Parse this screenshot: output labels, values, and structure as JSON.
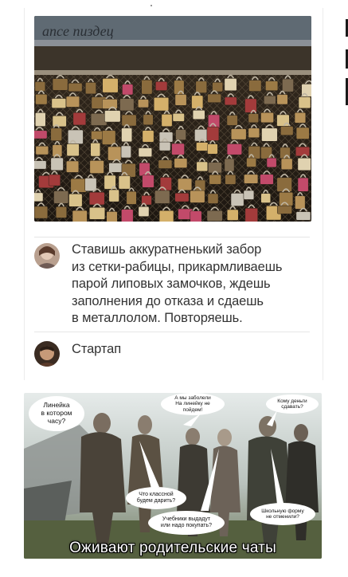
{
  "post": {
    "photo_sign_text": "ance пиздец",
    "comments": [
      {
        "text": "Ставишь аккуратненький забор\nиз сетки-рабицы, прикармливаешь\nпарой липовых замочков, ждешь\nзаполнения до отказа и сдаешь\nв металлолом. Повторяешь."
      },
      {
        "text": "Стартап"
      }
    ]
  },
  "meme": {
    "bubbles": [
      "Линейка\nв котором\nчасу?",
      "А мы заболели\nНа линейку не\nпойдем!",
      "Кому деньги\nсдавать?",
      "Что классной\nбудем дарить?",
      "Учебники выдадут\nили надо покупать?",
      "Школьную форму\nне отменили?"
    ],
    "caption": "Оживают родительские чаты"
  },
  "colors": {
    "text": "#333333",
    "separator": "#e6e6e6"
  }
}
